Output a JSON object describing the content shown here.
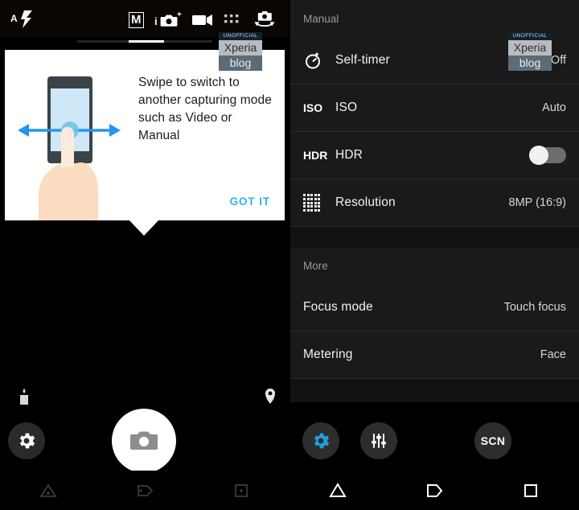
{
  "left_panel": {
    "name": "camera-viewfinder",
    "topbar": {
      "flash_icon": "auto-flash-icon",
      "flash_label": "A",
      "mode_manual_label": "M",
      "mode_photo_icon": "intelligent-auto-camera-icon",
      "mode_video_icon": "video-camera-icon",
      "mode_apps_icon": "camera-apps-grid-icon",
      "switch_camera_icon": "switch-camera-icon"
    },
    "tooltip": {
      "message": "Swipe to switch to another capturing mode such as Video or Manual",
      "action_label": "GOT IT",
      "illustration": "swipe-gesture-phone-hand-illustration"
    },
    "status": {
      "storage_icon": "internal-storage-icon",
      "location_icon": "location-pin-icon"
    },
    "controls": {
      "settings_icon": "gear-icon",
      "shutter_icon": "camera-shutter-icon"
    },
    "navbar": {
      "back_icon": "back-triangle-icon",
      "home_icon": "home-pentagon-icon",
      "recents_icon": "recents-square-icon"
    }
  },
  "right_panel": {
    "name": "camera-settings",
    "sections": [
      {
        "title": "Manual",
        "rows": [
          {
            "icon": "self-timer-icon",
            "icon_text": "",
            "label": "Self-timer",
            "value": "Off",
            "control": "value"
          },
          {
            "icon": "iso-icon",
            "icon_text": "ISO",
            "label": "ISO",
            "value": "Auto",
            "control": "value"
          },
          {
            "icon": "hdr-icon",
            "icon_text": "HDR",
            "label": "HDR",
            "value": "",
            "control": "toggle",
            "toggle_on": false
          },
          {
            "icon": "resolution-grid-icon",
            "icon_text": "",
            "label": "Resolution",
            "value": "8MP (16:9)",
            "control": "value"
          }
        ]
      },
      {
        "title": "More",
        "rows": [
          {
            "icon": "",
            "icon_text": "",
            "label": "Focus mode",
            "value": "Touch focus",
            "control": "value"
          },
          {
            "icon": "",
            "icon_text": "",
            "label": "Metering",
            "value": "Face",
            "control": "value"
          }
        ]
      }
    ],
    "controls": {
      "settings_icon": "gear-icon-active",
      "manual_sliders_icon": "sliders-icon",
      "shutter_icon": "camera-shutter-icon",
      "scene_label": "SCN"
    },
    "navbar": {
      "back_icon": "back-triangle-icon",
      "home_icon": "home-pentagon-icon",
      "recents_icon": "recents-square-icon"
    }
  },
  "watermark": {
    "line1": "UNOFFICIAL",
    "line2": "Xperia",
    "line3": "blog"
  },
  "colors": {
    "accent_blue": "#29b6f6",
    "gear_active_blue": "#1e9fe0",
    "panel_bg": "#1a1a1a",
    "screen_bg": "#000000",
    "tooltip_bg": "#ffffff"
  }
}
